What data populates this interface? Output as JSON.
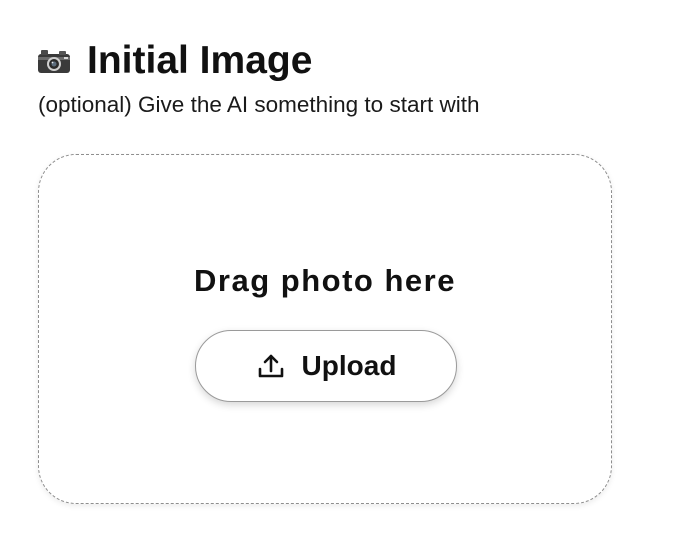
{
  "header": {
    "title": "Initial Image",
    "icon": "camera-icon",
    "subtitle": "(optional) Give the AI something to start with"
  },
  "dropzone": {
    "prompt": "Drag photo here",
    "upload_button": {
      "label": "Upload",
      "icon": "upload-icon"
    }
  },
  "colors": {
    "text": "#111111",
    "border": "#8e8e8e",
    "background": "#ffffff"
  }
}
